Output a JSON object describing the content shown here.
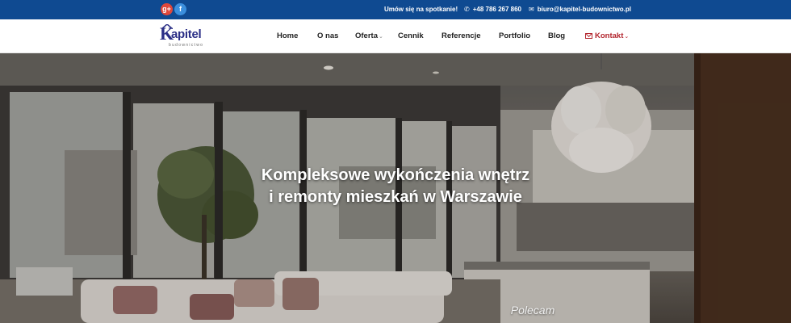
{
  "topbar": {
    "social": [
      {
        "icon": "google-plus-icon",
        "glyph": "g+"
      },
      {
        "icon": "facebook-icon",
        "glyph": "f"
      }
    ],
    "meeting_label": "Umów się na spotkanie!",
    "phone": "+48 786 267 860",
    "email": "biuro@kapitel-budownictwo.pl"
  },
  "logo": {
    "k": "K",
    "word": "apitel",
    "tagline": "budownictwo"
  },
  "nav": {
    "items": [
      {
        "label": "Home"
      },
      {
        "label": "O nas"
      },
      {
        "label": "Oferta",
        "has_dropdown": true
      },
      {
        "label": "Cennik"
      },
      {
        "label": "Referencje"
      },
      {
        "label": "Portfolio"
      },
      {
        "label": "Blog"
      },
      {
        "label": "Kontakt",
        "has_dropdown": true,
        "active": true,
        "icon": "envelope-icon"
      }
    ],
    "chevron": "⌄"
  },
  "hero": {
    "title_line1": "Kompleksowe wykończenia wnętrz",
    "title_line2": "i remonty mieszkań w Warszawie",
    "subtitle": "Polecam"
  },
  "colors": {
    "topbar_bg": "#0f4a91",
    "brand": "#2b2f86",
    "active_nav": "#b3262e"
  }
}
